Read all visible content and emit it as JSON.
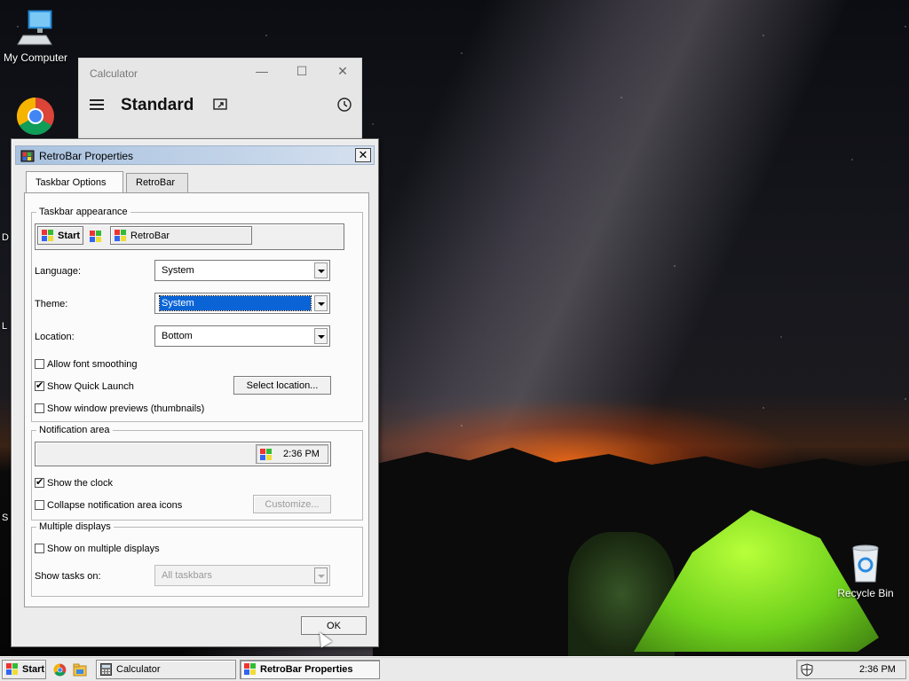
{
  "desktop": {
    "icons": {
      "my_computer": "My Computer",
      "recycle_bin": "Recycle Bin"
    }
  },
  "calculator": {
    "title": "Calculator",
    "mode": "Standard"
  },
  "dialog": {
    "title": "RetroBar Properties",
    "tabs": [
      {
        "label": "Taskbar Options",
        "active": true
      },
      {
        "label": "RetroBar",
        "active": false
      }
    ],
    "taskbar_appearance": {
      "legend": "Taskbar appearance",
      "preview_start": "Start",
      "preview_window": "RetroBar"
    },
    "language": {
      "label": "Language:",
      "value": "System"
    },
    "theme": {
      "label": "Theme:",
      "value": "System"
    },
    "location": {
      "label": "Location:",
      "value": "Bottom"
    },
    "allow_font_smoothing": {
      "label": "Allow font smoothing",
      "checked": false
    },
    "show_quick_launch": {
      "label": "Show Quick Launch",
      "checked": true
    },
    "select_location_button": "Select location...",
    "show_window_previews": {
      "label": "Show window previews (thumbnails)",
      "checked": false
    },
    "notification_area": {
      "legend": "Notification area",
      "preview_clock": "2:36 PM",
      "show_clock": {
        "label": "Show the clock",
        "checked": true
      },
      "collapse_icons": {
        "label": "Collapse notification area icons",
        "checked": false
      },
      "customize_button": "Customize..."
    },
    "multiple_displays": {
      "legend": "Multiple displays",
      "show_on_multiple": {
        "label": "Show on multiple displays",
        "checked": false
      },
      "show_tasks_on": {
        "label": "Show tasks on:",
        "value": "All taskbars"
      }
    },
    "ok_button": "OK"
  },
  "taskbar": {
    "start": "Start",
    "tasks": [
      {
        "label": "Calculator",
        "active": false
      },
      {
        "label": "RetroBar Properties",
        "active": true
      }
    ],
    "clock": "2:36 PM"
  }
}
